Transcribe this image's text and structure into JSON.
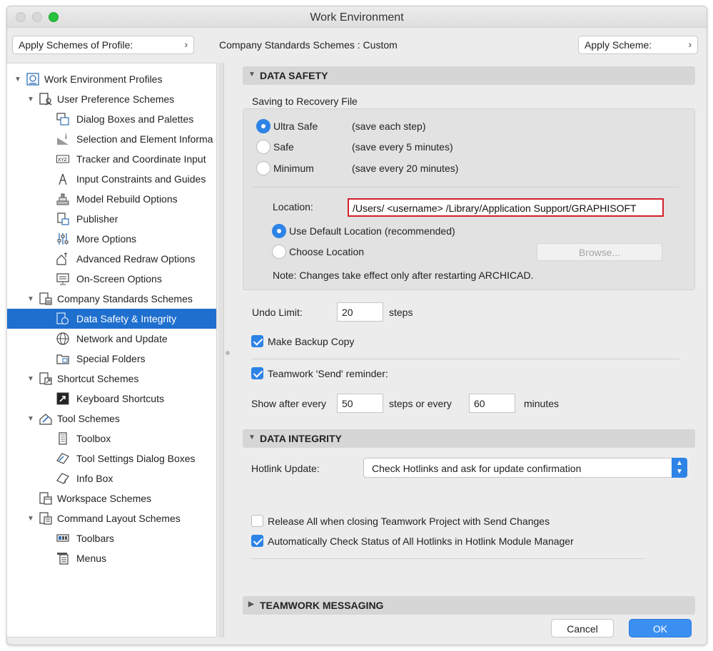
{
  "window": {
    "title": "Work Environment"
  },
  "topbar": {
    "apply_profile_label": "Apply Schemes of Profile:",
    "center_label": "Company Standards Schemes : Custom",
    "apply_scheme_label": "Apply Scheme:"
  },
  "tree": {
    "root": "Work Environment Profiles",
    "user_pref": "User Preference Schemes",
    "dialog_boxes": "Dialog Boxes and Palettes",
    "selection_info": "Selection and Element Informa",
    "tracker": "Tracker and Coordinate Input",
    "input_constraints": "Input Constraints and Guides",
    "model_rebuild": "Model Rebuild Options",
    "publisher": "Publisher",
    "more_options": "More Options",
    "advanced_redraw": "Advanced Redraw Options",
    "onscreen": "On-Screen Options",
    "company": "Company Standards Schemes",
    "data_safety": "Data Safety & Integrity",
    "network": "Network and Update",
    "special_folders": "Special Folders",
    "shortcut": "Shortcut Schemes",
    "keyboard": "Keyboard Shortcuts",
    "tool_schemes": "Tool Schemes",
    "toolbox": "Toolbox",
    "tool_settings": "Tool Settings Dialog Boxes",
    "info_box": "Info Box",
    "workspace": "Workspace Schemes",
    "command_layout": "Command Layout Schemes",
    "toolbars": "Toolbars",
    "menus": "Menus"
  },
  "data_safety": {
    "header": "DATA SAFETY",
    "saving_label": "Saving to Recovery File",
    "ultra_safe": "Ultra Safe",
    "ultra_safe_desc": "(save each step)",
    "safe": "Safe",
    "safe_desc": "(save every 5 minutes)",
    "minimum": "Minimum",
    "minimum_desc": "(save every 20 minutes)",
    "location_label": "Location:",
    "location_value": "/Users/ <username> /Library/Application Support/GRAPHISOFT",
    "use_default": "Use Default Location (recommended)",
    "choose_location": "Choose Location",
    "browse": "Browse...",
    "note": "Note: Changes take effect only after restarting ARCHICAD.",
    "undo_limit_label": "Undo Limit:",
    "undo_limit_value": "20",
    "undo_unit": "steps",
    "make_backup": "Make Backup Copy",
    "teamwork_reminder": "Teamwork 'Send' reminder:",
    "show_after": "Show after every",
    "steps_value": "50",
    "steps_or_every": "steps or every",
    "minutes_value": "60",
    "minutes": "minutes"
  },
  "data_integrity": {
    "header": "DATA INTEGRITY",
    "hotlink_label": "Hotlink Update:",
    "hotlink_value": "Check Hotlinks and ask for update confirmation",
    "release_all": "Release All when closing Teamwork Project with Send Changes",
    "auto_check": "Automatically Check Status of All Hotlinks in Hotlink Module Manager"
  },
  "teamwork_messaging": {
    "header": "TEAMWORK MESSAGING"
  },
  "footer": {
    "cancel": "Cancel",
    "ok": "OK"
  },
  "colors": {
    "accent": "#2d83e6",
    "selection": "#1f6fce",
    "highlight_border": "#d21f2b"
  }
}
